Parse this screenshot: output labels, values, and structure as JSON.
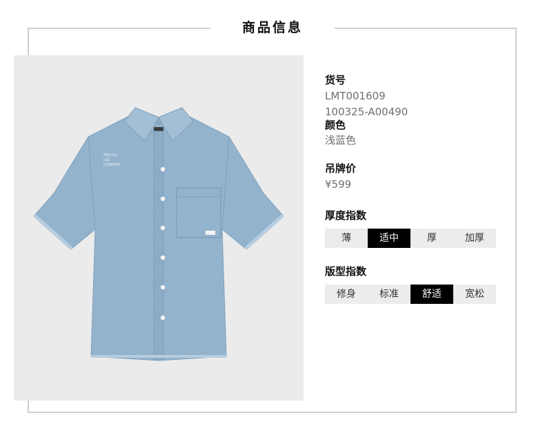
{
  "header": {
    "title": "商品信息"
  },
  "product": {
    "image_alt": "light blue denim short sleeve shirt",
    "print_text": [
      "THE H.D.",
      "LEE",
      "COMPANY"
    ]
  },
  "info": {
    "sku_label": "货号",
    "sku_values": [
      "LMT001609",
      "100325-A00490"
    ],
    "color_label": "颜色",
    "color_value": "浅蓝色",
    "price_label": "吊牌价",
    "price_value": "¥599",
    "thickness": {
      "label": "厚度指数",
      "options": [
        "薄",
        "适中",
        "厚",
        "加厚"
      ],
      "selected": "适中"
    },
    "fit": {
      "label": "版型指数",
      "options": [
        "修身",
        "标准",
        "舒适",
        "宽松"
      ],
      "selected": "舒适"
    }
  },
  "colors": {
    "frame": "#cfcfcf",
    "photo_bg": "#ebebeb",
    "denim": "#93b3cd",
    "active_bg": "#000000",
    "inactive_bg": "#ececec"
  }
}
